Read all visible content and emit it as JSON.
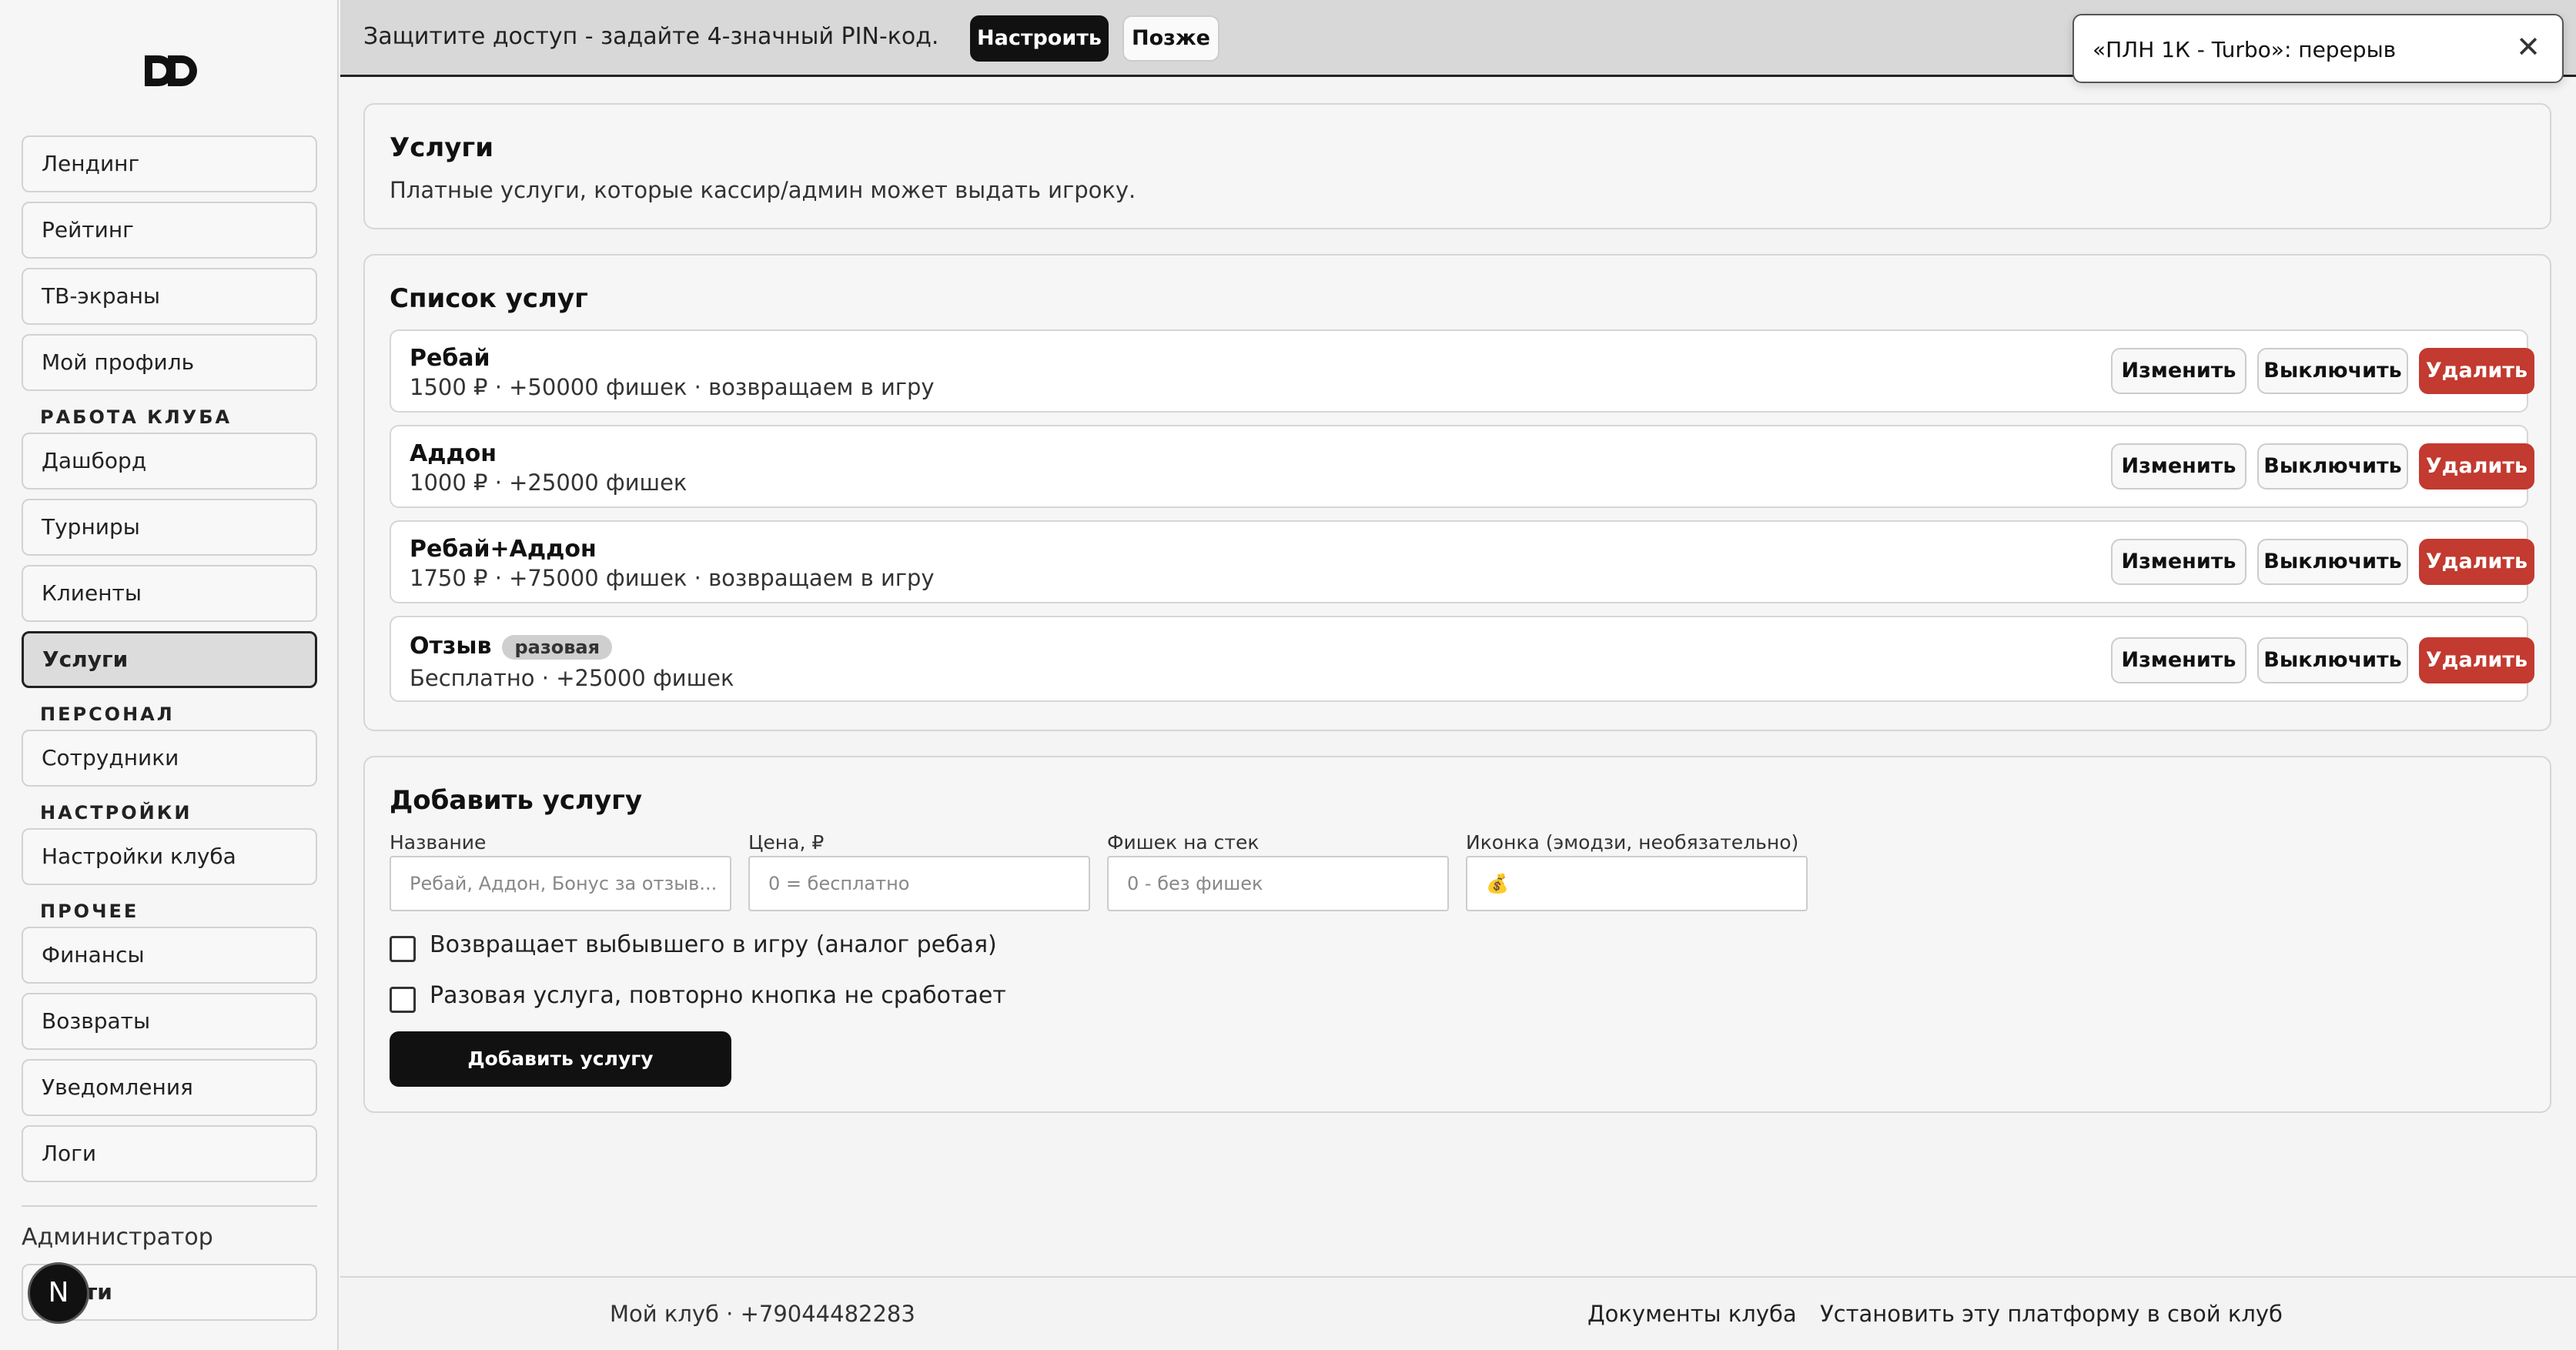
{
  "sidebar": {
    "items": [
      {
        "label": "Лендинг"
      },
      {
        "label": "Рейтинг"
      },
      {
        "label": "ТВ-экраны"
      },
      {
        "label": "Мой профиль"
      },
      {
        "label": "Дашборд"
      },
      {
        "label": "Турниры"
      },
      {
        "label": "Клиенты"
      },
      {
        "label": "Услуги"
      },
      {
        "label": "Сотрудники"
      },
      {
        "label": "Настройки клуба"
      },
      {
        "label": "Финансы"
      },
      {
        "label": "Возвраты"
      },
      {
        "label": "Уведомления"
      },
      {
        "label": "Логи"
      }
    ],
    "sections": {
      "club_work": "РАБОТА КЛУБА",
      "staff": "ПЕРСОНАЛ",
      "settings": "НАСТРОЙКИ",
      "other": "ПРОЧЕЕ"
    },
    "admin_label": "Администратор",
    "logout_label": "ти",
    "n_badge": "N"
  },
  "banner": {
    "text": "Защитите доступ - задайте 4-значный PIN-код.",
    "setup_label": "Настроить",
    "later_label": "Позже"
  },
  "toast": {
    "text": "«ПЛН 1К - Turbo»: перерыв",
    "close": "✕"
  },
  "services_header": {
    "title": "Услуги",
    "subtitle": "Платные услуги, которые кассир/админ может выдать игроку."
  },
  "service_list": {
    "title": "Список услуг",
    "edit_label": "Изменить",
    "disable_label": "Выключить",
    "delete_label": "Удалить",
    "items": [
      {
        "name": "Ребай",
        "desc": "1500 ₽ · +50000 фишек · возвращаем в игру"
      },
      {
        "name": "Аддон",
        "desc": "1000 ₽ · +25000 фишек"
      },
      {
        "name": "Ребай+Аддон",
        "desc": "1750 ₽ · +75000 фишек · возвращаем в игру"
      },
      {
        "name": "Отзыв",
        "tag": "разовая",
        "desc": "Бесплатно · +25000 фишек"
      }
    ]
  },
  "add_service": {
    "title": "Добавить услугу",
    "name_label": "Название",
    "name_placeholder": "Ребай, Аддон, Бонус за отзыв...",
    "price_label": "Цена, ₽",
    "price_placeholder": "0 = бесплатно",
    "chips_label": "Фишек на стек",
    "chips_placeholder": "0 - без фишек",
    "icon_label": "Иконка (эмодзи, необязательно)",
    "icon_placeholder": "💰",
    "check_return": "Возвращает выбывшего в игру (аналог ребая)",
    "check_once": "Разовая услуга, повторно кнопка не сработает",
    "submit_label": "Добавить услугу"
  },
  "footer": {
    "club": "Мой клуб · +79044482283",
    "docs": "Документы клуба",
    "install": "Установить эту платформу в свой клуб"
  }
}
